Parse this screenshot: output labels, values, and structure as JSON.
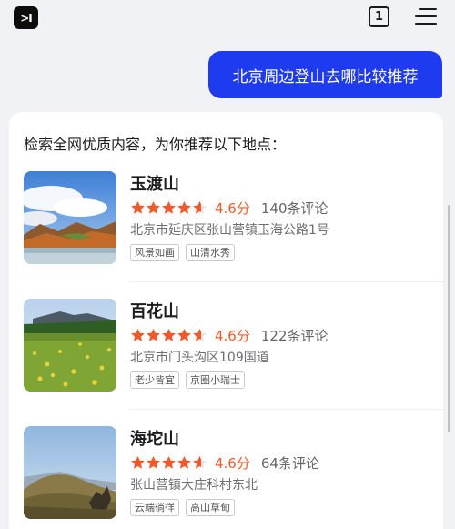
{
  "topbar": {
    "logo_text": ">I",
    "tab_count": "1"
  },
  "chat": {
    "user_message": "北京周边登山去哪比较推荐",
    "answer_intro": "检索全网优质内容，为你推荐以下地点："
  },
  "places": [
    {
      "name": "玉渡山",
      "rating": 4.6,
      "score_text": "4.6分",
      "reviews": "140条评论",
      "address": "北京市延庆区张山营镇玉海公路1号",
      "tags": [
        "风景如画",
        "山清水秀"
      ]
    },
    {
      "name": "百花山",
      "rating": 4.6,
      "score_text": "4.6分",
      "reviews": "122条评论",
      "address": "北京市门头沟区109国道",
      "tags": [
        "老少皆宜",
        "京圈小瑞士"
      ]
    },
    {
      "name": "海坨山",
      "rating": 4.6,
      "score_text": "4.6分",
      "reviews": "64条评论",
      "address": "张山营镇大庄科村东北",
      "tags": [
        "云端徜徉",
        "高山草甸"
      ]
    }
  ],
  "colors": {
    "accent_blue": "#1f3bf0",
    "star_orange": "#f05a2a",
    "background": "#f1f2f6"
  },
  "icons": {
    "logo": "app-logo-icon",
    "tabs": "tabs-count-icon",
    "menu": "hamburger-menu-icon",
    "star": "star-icon"
  }
}
